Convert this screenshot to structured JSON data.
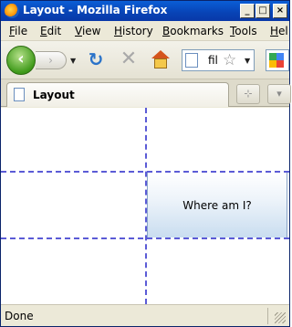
{
  "window": {
    "title": "Layout - Mozilla Firefox",
    "buttons": {
      "minimize": "_",
      "maximize": "□",
      "close": "×"
    }
  },
  "menubar": {
    "items": [
      {
        "accel": "F",
        "rest": "ile"
      },
      {
        "accel": "E",
        "rest": "dit"
      },
      {
        "accel": "V",
        "rest": "iew"
      },
      {
        "accel": "H",
        "rest": "istory"
      },
      {
        "accel": "B",
        "rest": "ookmarks"
      },
      {
        "accel": "T",
        "rest": "ools"
      },
      {
        "accel": "H",
        "rest": "el"
      }
    ]
  },
  "navbar": {
    "back_glyph": "‹",
    "forward_glyph": "›",
    "dropdown_glyph": "▼",
    "reload_glyph": "↻",
    "stop_glyph": "✕",
    "url_partial": "fil",
    "bookmark_star": "☆",
    "url_dropdown": "▼"
  },
  "tabs": {
    "active_label": "Layout",
    "list_tabs_glyph": "⊹",
    "more_glyph": "▾"
  },
  "content": {
    "cell_text": "Where am I?"
  },
  "statusbar": {
    "text": "Done"
  },
  "colors": {
    "titlebar": "#0843b5",
    "grid_dash": "#5b5bd6",
    "cell_gradient_bottom": "#c9ddf0"
  }
}
